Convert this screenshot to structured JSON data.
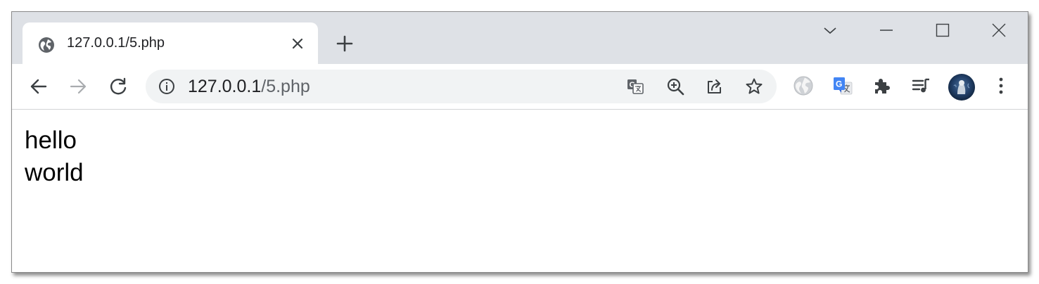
{
  "tab": {
    "title": "127.0.0.1/5.php"
  },
  "address_bar": {
    "host": "127.0.0.1",
    "path": "/5.php"
  },
  "icons": {
    "tab_favicon": "globe-icon",
    "tab_close": "close-icon",
    "new_tab": "plus-icon",
    "tab_search": "chevron-down-icon",
    "minimize": "minimize-icon",
    "maximize": "maximize-icon",
    "close_window": "close-icon",
    "back": "arrow-left-icon",
    "forward": "arrow-right-icon",
    "reload": "reload-icon",
    "site_info": "info-icon",
    "translate": "translate-icon",
    "zoom": "zoom-in-icon",
    "share": "share-icon",
    "bookmark": "star-icon",
    "extension_globe": "globe-extension-icon",
    "extension_google_translate": "google-translate-icon",
    "extensions": "puzzle-icon",
    "media": "media-queue-icon",
    "profile": "avatar",
    "menu": "kebab-menu-icon"
  },
  "colors": {
    "tabstrip_bg": "#dee1e6",
    "omnibox_bg": "#f1f3f4",
    "icon": "#5f6368",
    "forward_disabled": "#a9acaf",
    "translate_blue": "#4285f4"
  },
  "page": {
    "lines": [
      "hello",
      "world"
    ]
  }
}
